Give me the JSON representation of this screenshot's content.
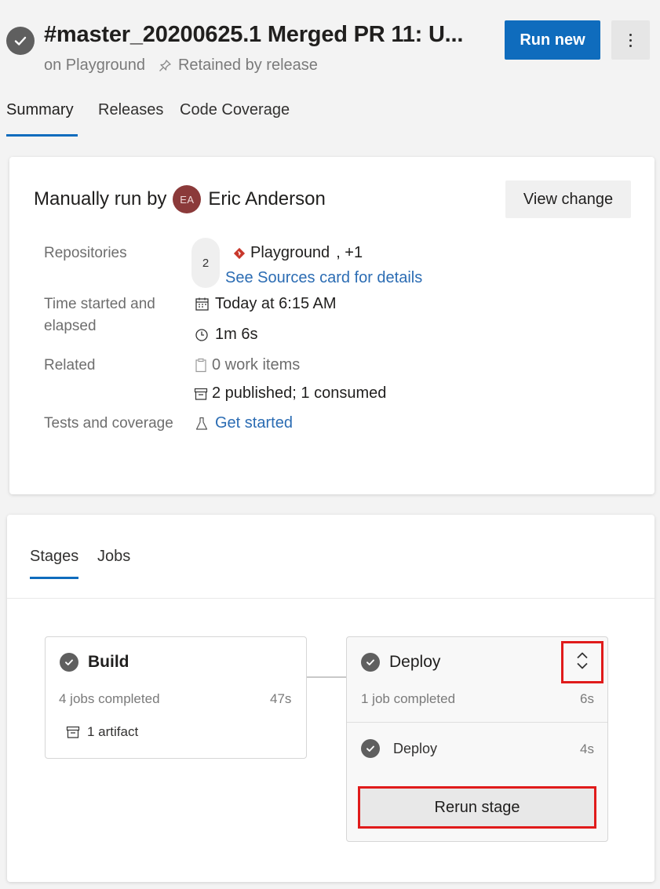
{
  "header": {
    "title": "#master_20200625.1 Merged PR 11: U...",
    "project": "on Playground",
    "retention": "Retained by release",
    "run_new_label": "Run new",
    "status_icon": "check-circle-icon",
    "more_icon": "more-vertical-icon"
  },
  "tabs": [
    {
      "label": "Summary",
      "active": true
    },
    {
      "label": "Releases",
      "active": false
    },
    {
      "label": "Code Coverage",
      "active": false
    }
  ],
  "summary": {
    "manual_run_label": "Manually run by",
    "user_initials": "EA",
    "user_name": "Eric Anderson",
    "view_change_label": "View change",
    "repositories_label": "Repositories",
    "repo_count": "2",
    "repo_name": "Playground",
    "repo_extra": ", +1",
    "sources_link": "See Sources card for details",
    "time_label_1": "Time started and",
    "time_label_2": "elapsed",
    "started": "Today at 6:15 AM",
    "elapsed": "1m 6s",
    "related_label": "Related",
    "work_items": "0 work items",
    "artifacts_summary": "2 published; 1 consumed",
    "tests_label": "Tests and coverage",
    "get_started": "Get started"
  },
  "stages_panel": {
    "tabs": [
      {
        "label": "Stages",
        "active": true
      },
      {
        "label": "Jobs",
        "active": false
      }
    ],
    "build": {
      "name": "Build",
      "jobs": "4 jobs completed",
      "duration": "47s",
      "artifact": "1 artifact"
    },
    "deploy": {
      "name": "Deploy",
      "jobs": "1 job completed",
      "duration": "6s",
      "job_name": "Deploy",
      "job_duration": "4s",
      "rerun_label": "Rerun stage"
    }
  },
  "colors": {
    "accent": "#0f6cbd",
    "status": "#5f5f5f",
    "highlight": "#e01b1b"
  }
}
